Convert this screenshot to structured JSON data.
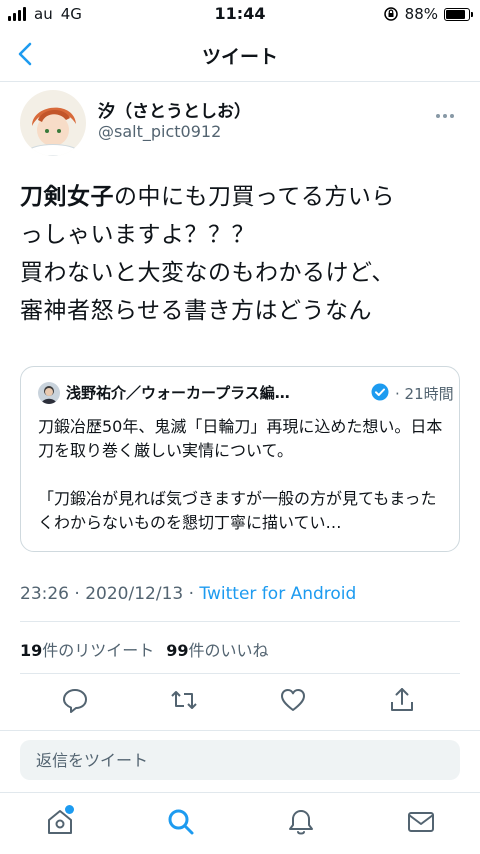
{
  "status_bar": {
    "carrier": "au",
    "network": "4G",
    "time": "11:44",
    "battery": "88%",
    "battery_level": 0.88
  },
  "nav": {
    "title": "ツイート"
  },
  "author": {
    "name": "汐（さとうとしお）",
    "handle": "@salt_pict0912"
  },
  "tweet": {
    "highlight": "刀剣女子",
    "text": "の中にも刀買ってる方いら\nっしゃいますよ？？？\n買わないと大変なのもわかるけど、\n審神者怒らせる書き方はどうなん"
  },
  "quote": {
    "name": "浅野祐介／ウォーカープラス編…",
    "time": "21時間",
    "body": "刀鍛冶歴50年、鬼滅「日輪刀」再現に込めた想い。日本刀を取り巻く厳しい実情について。\n\n「刀鍛冶が見れば気づきますが一般の方が見てもまったくわからないものを懇切丁寧に描いてい…"
  },
  "meta": {
    "time": "23:26",
    "date": "2020/12/13",
    "sep": "·",
    "app": "Twitter for Android"
  },
  "stats": {
    "retweets": "19",
    "retweets_label": "件のリツイート",
    "likes": "99",
    "likes_label": "件のいいね"
  },
  "reply": {
    "placeholder": "返信をツイート"
  },
  "colors": {
    "accent": "#1d9bf0",
    "text": "#0f1419",
    "muted": "#536471"
  }
}
